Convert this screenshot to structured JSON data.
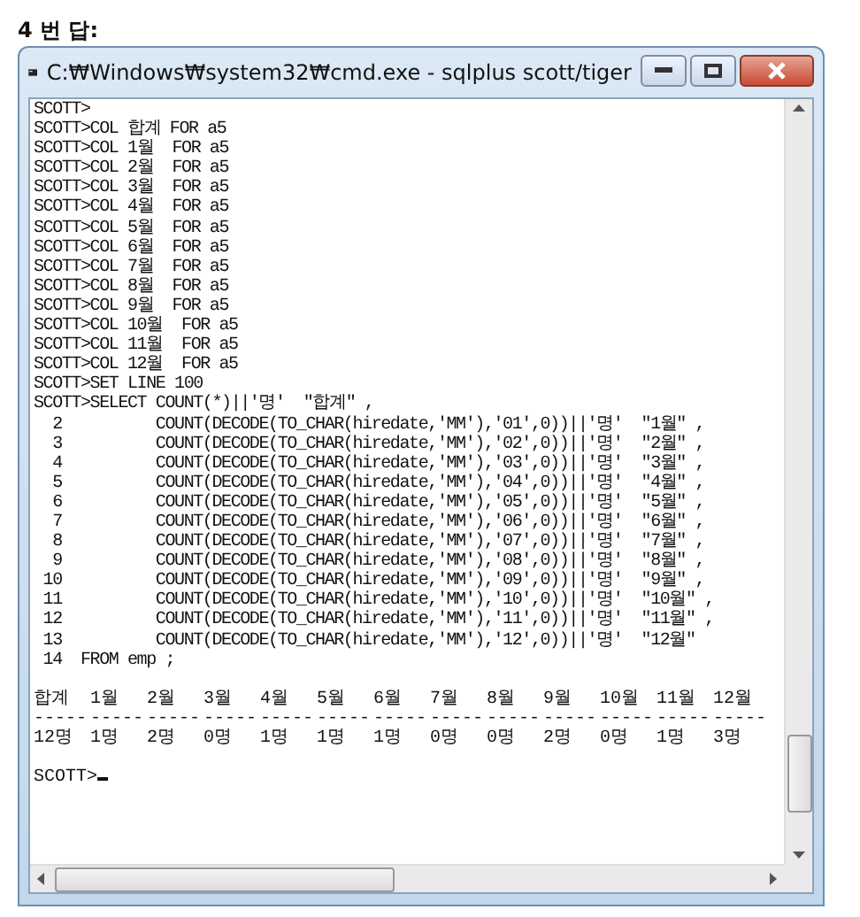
{
  "heading": "4 번 답:",
  "window": {
    "title": "C:₩Windows₩system32₩cmd.exe - sqlplus  scott/tiger"
  },
  "console": {
    "lines": [
      "SCOTT>",
      "SCOTT>COL 합계 FOR a5",
      "SCOTT>COL 1월  FOR a5",
      "SCOTT>COL 2월  FOR a5",
      "SCOTT>COL 3월  FOR a5",
      "SCOTT>COL 4월  FOR a5",
      "SCOTT>COL 5월  FOR a5",
      "SCOTT>COL 6월  FOR a5",
      "SCOTT>COL 7월  FOR a5",
      "SCOTT>COL 8월  FOR a5",
      "SCOTT>COL 9월  FOR a5",
      "SCOTT>COL 10월  FOR a5",
      "SCOTT>COL 11월  FOR a5",
      "SCOTT>COL 12월  FOR a5",
      "SCOTT>SET LINE 100",
      "SCOTT>SELECT COUNT(*)||'명'  \"합계\" ,",
      "  2          COUNT(DECODE(TO_CHAR(hiredate,'MM'),'01',0))||'명'  \"1월\" ,",
      "  3          COUNT(DECODE(TO_CHAR(hiredate,'MM'),'02',0))||'명'  \"2월\" ,",
      "  4          COUNT(DECODE(TO_CHAR(hiredate,'MM'),'03',0))||'명'  \"3월\" ,",
      "  5          COUNT(DECODE(TO_CHAR(hiredate,'MM'),'04',0))||'명'  \"4월\" ,",
      "  6          COUNT(DECODE(TO_CHAR(hiredate,'MM'),'05',0))||'명'  \"5월\" ,",
      "  7          COUNT(DECODE(TO_CHAR(hiredate,'MM'),'06',0))||'명'  \"6월\" ,",
      "  8          COUNT(DECODE(TO_CHAR(hiredate,'MM'),'07',0))||'명'  \"7월\" ,",
      "  9          COUNT(DECODE(TO_CHAR(hiredate,'MM'),'08',0))||'명'  \"8월\" ,",
      " 10          COUNT(DECODE(TO_CHAR(hiredate,'MM'),'09',0))||'명'  \"9월\" ,",
      " 11          COUNT(DECODE(TO_CHAR(hiredate,'MM'),'10',0))||'명'  \"10월\" ,",
      " 12          COUNT(DECODE(TO_CHAR(hiredate,'MM'),'11',0))||'명'  \"11월\" ,",
      " 13          COUNT(DECODE(TO_CHAR(hiredate,'MM'),'12',0))||'명'  \"12월\"",
      " 14  FROM emp ;"
    ],
    "result": [
      {
        "heading": "합계",
        "rule": "-----",
        "value": "12명"
      },
      {
        "heading": "1월",
        "rule": "-----",
        "value": "1명"
      },
      {
        "heading": "2월",
        "rule": "-----",
        "value": "2명"
      },
      {
        "heading": "3월",
        "rule": "-----",
        "value": "0명"
      },
      {
        "heading": "4월",
        "rule": "-----",
        "value": "1명"
      },
      {
        "heading": "5월",
        "rule": "-----",
        "value": "1명"
      },
      {
        "heading": "6월",
        "rule": "-----",
        "value": "1명"
      },
      {
        "heading": "7월",
        "rule": "-----",
        "value": "0명"
      },
      {
        "heading": "8월",
        "rule": "-----",
        "value": "0명"
      },
      {
        "heading": "9월",
        "rule": "-----",
        "value": "2명"
      },
      {
        "heading": "10월",
        "rule": "-----",
        "value": "0명"
      },
      {
        "heading": "11월",
        "rule": "-----",
        "value": "1명"
      },
      {
        "heading": "12월",
        "rule": "-----",
        "value": "3명"
      }
    ],
    "prompt": "SCOTT>"
  }
}
